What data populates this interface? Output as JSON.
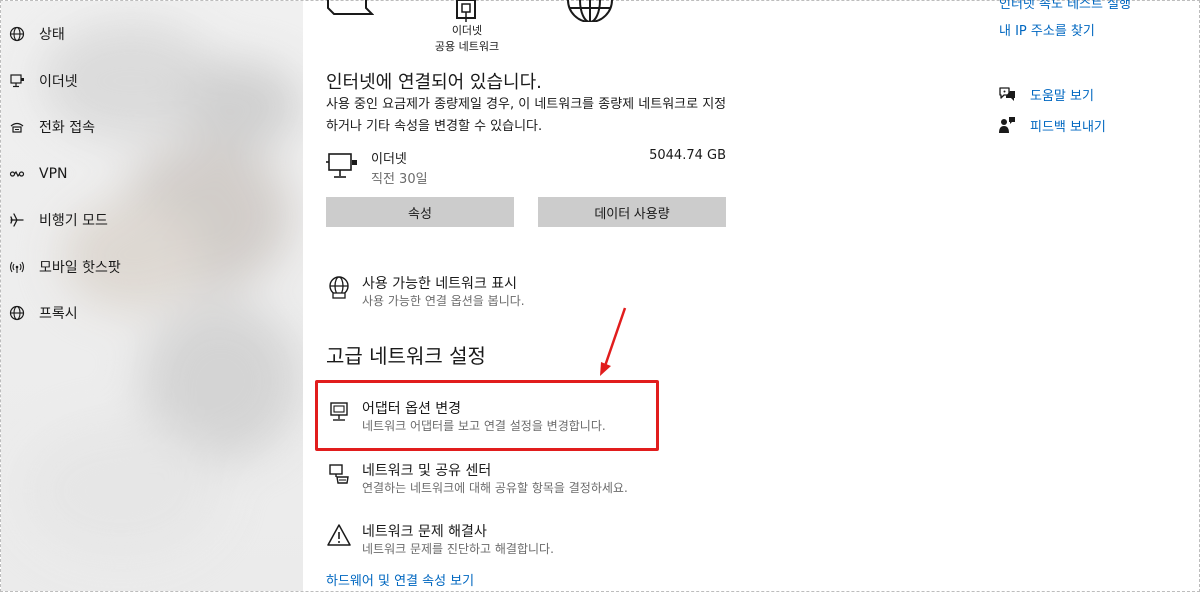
{
  "sidebar": {
    "items": [
      {
        "label": "상태",
        "icon": "globe-icon"
      },
      {
        "label": "이더넷",
        "icon": "monitor-network-icon"
      },
      {
        "label": "전화 접속",
        "icon": "dialup-icon"
      },
      {
        "label": "VPN",
        "icon": "vpn-icon"
      },
      {
        "label": "비행기 모드",
        "icon": "airplane-icon"
      },
      {
        "label": "모바일 핫스팟",
        "icon": "hotspot-icon"
      },
      {
        "label": "프록시",
        "icon": "globe-icon"
      }
    ]
  },
  "topology": {
    "middle_caption_line1": "이더넷",
    "middle_caption_line2": "공용 네트워크"
  },
  "status": {
    "title": "인터넷에 연결되어 있습니다.",
    "description": "사용 중인 요금제가 종량제일 경우, 이 네트워크를 종량제 네트워크로 지정하거나 기타 속성을 변경할 수 있습니다."
  },
  "usage": {
    "name": "이더넷",
    "period": "직전 30일",
    "amount": "5044.74 GB"
  },
  "buttons": {
    "properties": "속성",
    "data_usage": "데이터 사용량"
  },
  "show_networks": {
    "title": "사용 가능한 네트워크 표시",
    "desc": "사용 가능한 연결 옵션을 봅니다."
  },
  "advanced": {
    "heading": "고급 네트워크 설정",
    "items": [
      {
        "title": "어댑터 옵션 변경",
        "desc": "네트워크 어댑터를 보고 연결 설정을 변경합니다.",
        "icon": "adapter-icon"
      },
      {
        "title": "네트워크 및 공유 센터",
        "desc": "연결하는 네트워크에 대해 공유할 항목을 결정하세요.",
        "icon": "sharing-center-icon"
      },
      {
        "title": "네트워크 문제 해결사",
        "desc": "네트워크 문제를 진단하고 해결합니다.",
        "icon": "warning-icon"
      }
    ],
    "hardware_link": "하드웨어 및 연결 속성 보기"
  },
  "right": {
    "speed_test_link": "인터넷 속도 테스트 실행",
    "find_ip_link": "내 IP 주소를 찾기",
    "help_link": "도움말 보기",
    "feedback_link": "피드백 보내기"
  },
  "colors": {
    "accent_link": "#0067c0",
    "highlight_red": "#e11d1d",
    "button_gray": "#cccccc"
  }
}
